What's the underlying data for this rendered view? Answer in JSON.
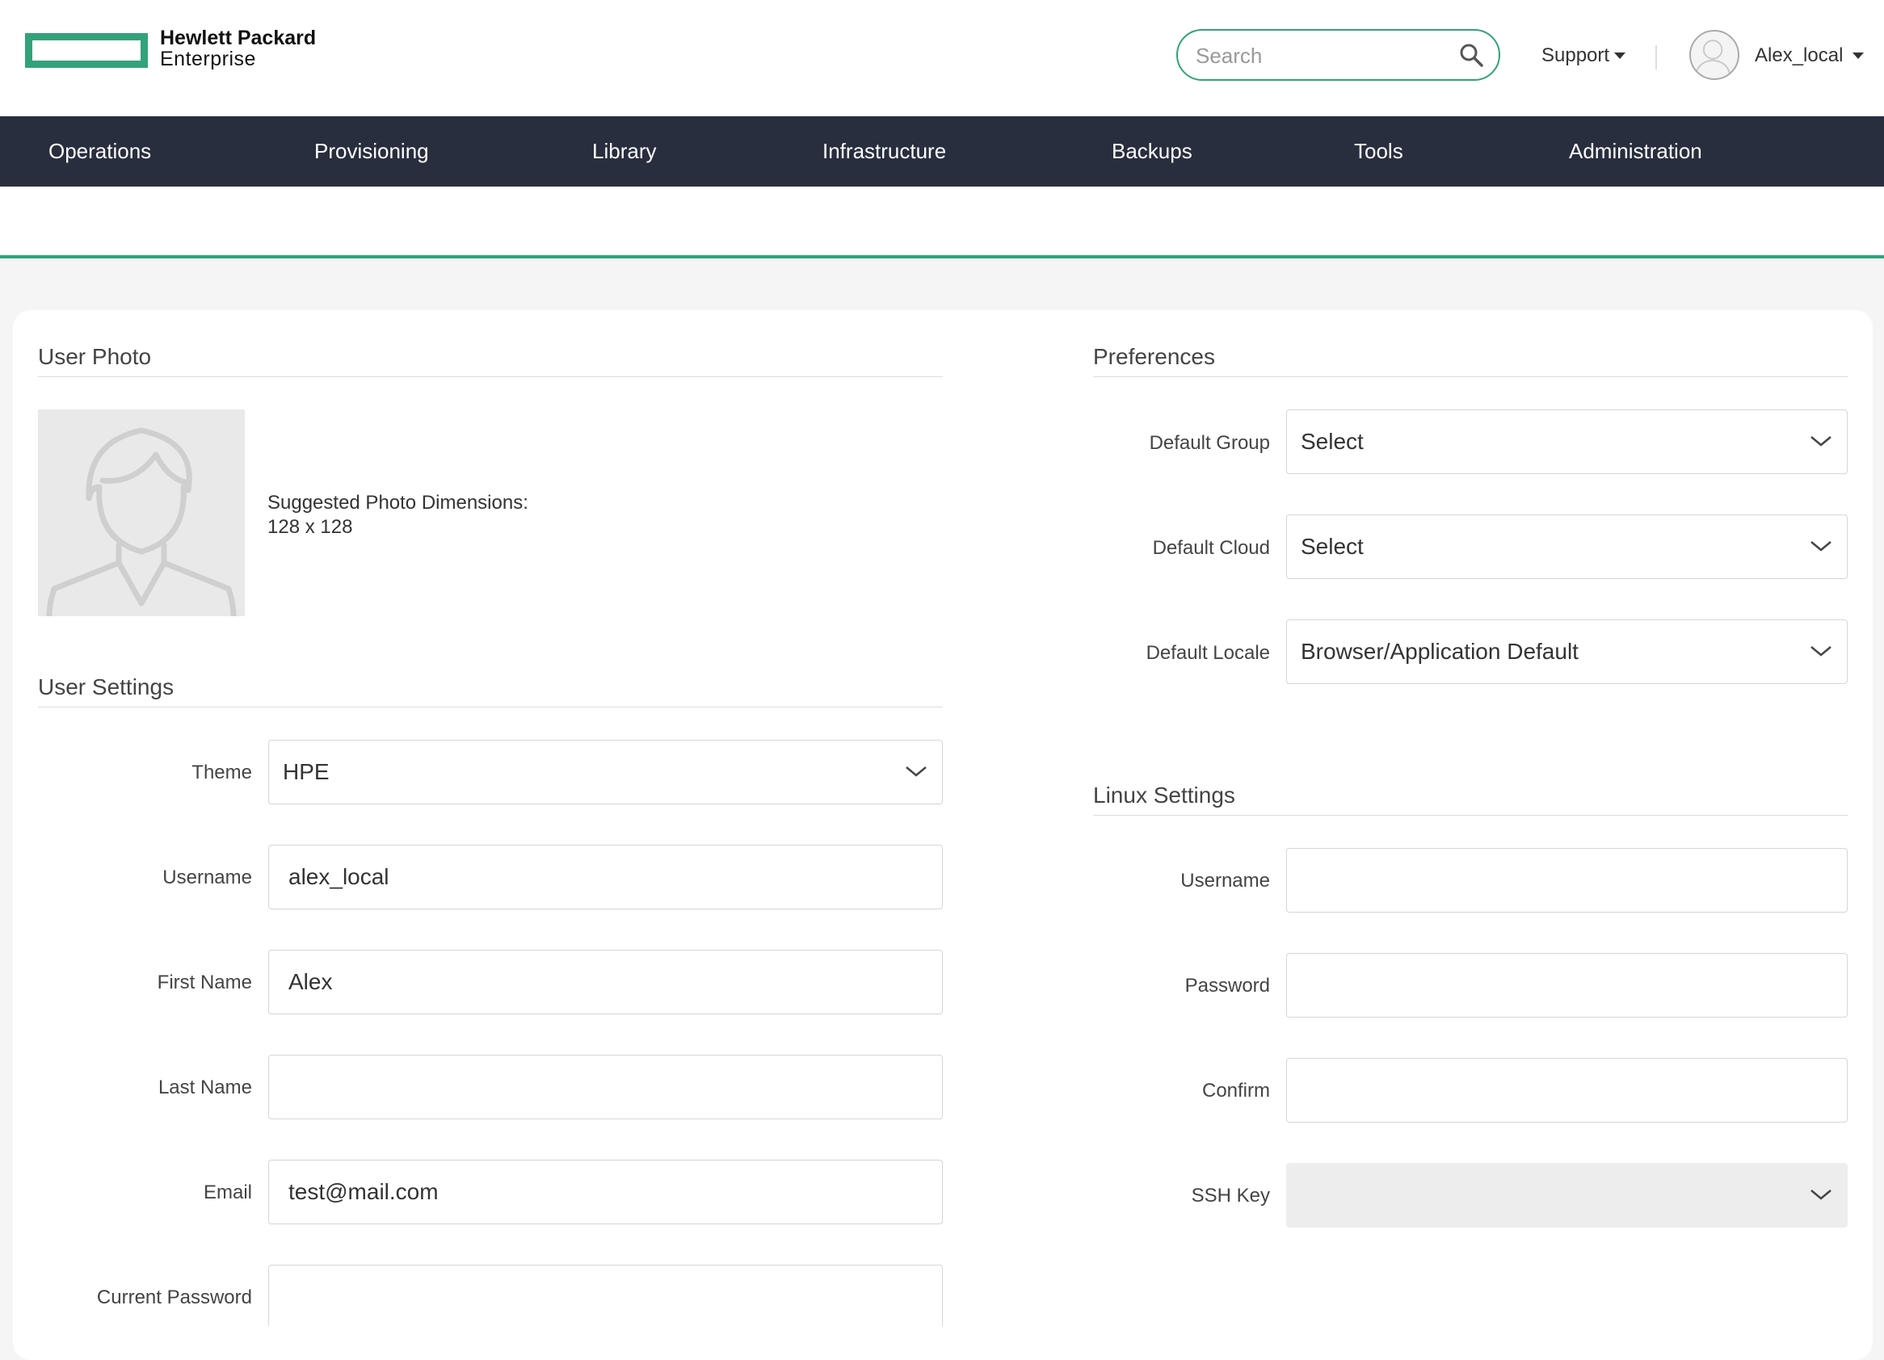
{
  "brand": {
    "line1": "Hewlett Packard",
    "line2": "Enterprise",
    "color": "#32a27a"
  },
  "header": {
    "search_placeholder": "Search",
    "support_label": "Support",
    "user_label": "Alex_local"
  },
  "nav": {
    "bg_color": "#282e3e",
    "items": [
      "Operations",
      "Provisioning",
      "Library",
      "Infrastructure",
      "Backups",
      "Tools",
      "Administration"
    ]
  },
  "user_photo": {
    "title": "User Photo",
    "hint_line1": "Suggested Photo Dimensions:",
    "hint_line2": "128 x 128"
  },
  "user_settings": {
    "title": "User Settings",
    "theme_label": "Theme",
    "theme_value": "HPE",
    "username_label": "Username",
    "username_value": "alex_local",
    "first_name_label": "First Name",
    "first_name_value": "Alex",
    "last_name_label": "Last Name",
    "last_name_value": "",
    "email_label": "Email",
    "email_value": "test@mail.com",
    "current_password_label": "Current Password",
    "current_password_value": ""
  },
  "preferences": {
    "title": "Preferences",
    "default_group_label": "Default Group",
    "default_group_value": "Select",
    "default_cloud_label": "Default Cloud",
    "default_cloud_value": "Select",
    "default_locale_label": "Default Locale",
    "default_locale_value": "Browser/Application Default"
  },
  "linux_settings": {
    "title": "Linux Settings",
    "username_label": "Username",
    "password_label": "Password",
    "confirm_label": "Confirm",
    "ssh_key_label": "SSH Key",
    "ssh_key_value": ""
  }
}
